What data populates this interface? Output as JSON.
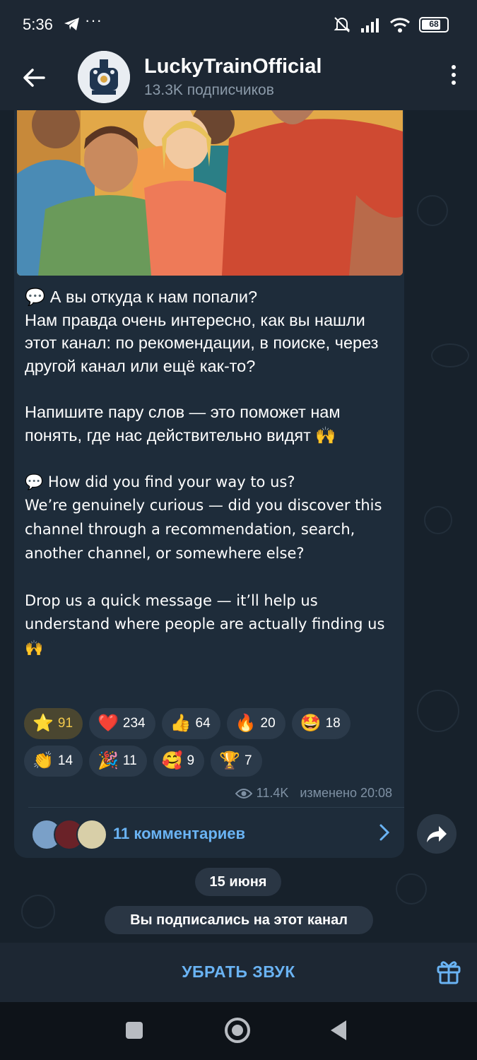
{
  "status_bar": {
    "time": "5:36",
    "dots": "···",
    "battery": "68"
  },
  "header": {
    "title": "LuckyTrainOfficial",
    "subtitle": "13.3K подписчиков"
  },
  "message": {
    "text_ru": "💬 А вы откуда к нам попали?\nНам правда очень интересно, как вы нашли этот канал: по рекомендации, в поиске, через другой канал или ещё как-то?\n\nНапишите пару слов — это поможет нам понять, где нас действительно видят 🙌",
    "text_en": "💬 How did you find your way to us?\nWe’re genuinely curious — did you discover this channel through a recommendation, search, another channel, or somewhere else?\n\nDrop us a quick message — it’ll help us understand where people are actually finding us 🙌",
    "reactions": [
      {
        "emoji": "⭐",
        "count": "91",
        "selected": true
      },
      {
        "emoji": "❤️",
        "count": "234"
      },
      {
        "emoji": "👍",
        "count": "64"
      },
      {
        "emoji": "🔥",
        "count": "20"
      },
      {
        "emoji": "🤩",
        "count": "18"
      },
      {
        "emoji": "👏",
        "count": "14"
      },
      {
        "emoji": "🎉",
        "count": "11"
      },
      {
        "emoji": "🥰",
        "count": "9"
      },
      {
        "emoji": "🏆",
        "count": "7"
      }
    ],
    "views": "11.4K",
    "edited": "изменено 20:08",
    "comments_label": "11 комментариев"
  },
  "service": {
    "date": "15 июня",
    "joined": "Вы подписались на этот канал"
  },
  "bottom": {
    "mute_label": "УБРАТЬ ЗВУК"
  },
  "colors": {
    "accent": "#6ab3f3",
    "bubble": "#1e2c3a",
    "header": "#1d2733"
  }
}
